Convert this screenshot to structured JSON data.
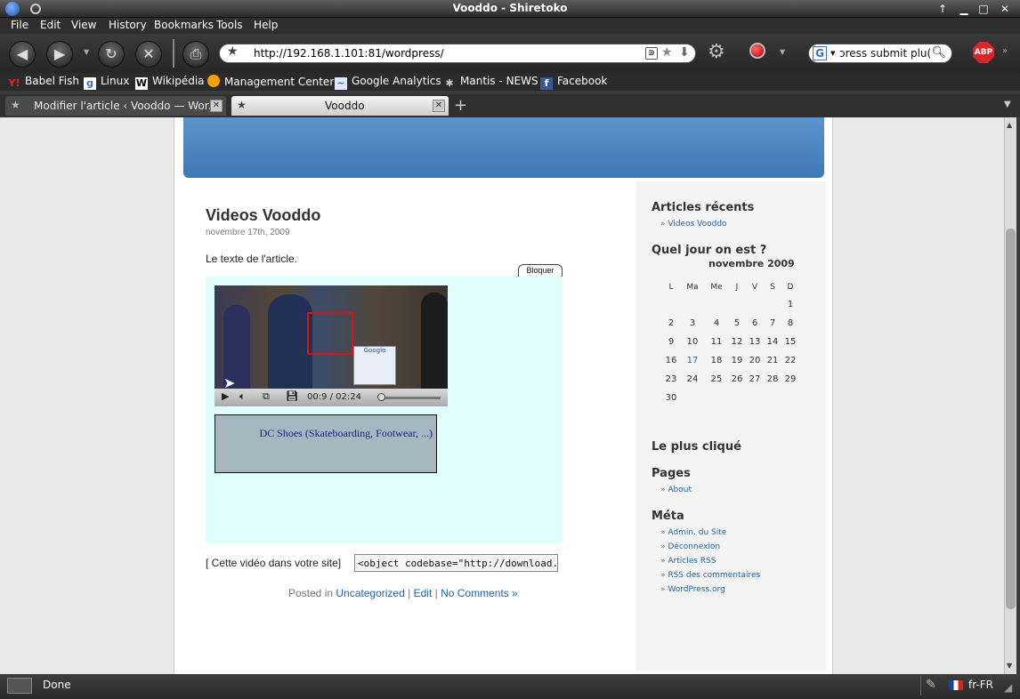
{
  "window": {
    "title": "Vooddo - Shiretoko"
  },
  "menu": {
    "file": "File",
    "edit": "Edit",
    "view": "View",
    "history": "History",
    "bookmarks": "Bookmarks",
    "tools": "Tools",
    "help": "Help"
  },
  "toolbar": {
    "url": "http://192.168.1.101:81/wordpress/",
    "search_value": "ɔress submit plu(",
    "search_engine": "G",
    "adblock": "ABP"
  },
  "bookmarks": [
    {
      "label": "Babel Fish",
      "icon": "yahoo-icon"
    },
    {
      "label": "Linux",
      "icon": "google-icon"
    },
    {
      "label": "Wikipédia",
      "icon": "wikipedia-icon"
    },
    {
      "label": "Management Center",
      "icon": "orange-circle-icon"
    },
    {
      "label": "Google Analytics",
      "icon": "analytics-icon"
    },
    {
      "label": "Mantis - NEWS",
      "icon": "bug-icon"
    },
    {
      "label": "Facebook",
      "icon": "facebook-icon"
    }
  ],
  "tabs": [
    {
      "label": "Modifier l'article ‹ Vooddo — Wor...",
      "active": false
    },
    {
      "label": "Vooddo",
      "active": true
    }
  ],
  "post": {
    "title": "Videos Vooddo",
    "date": "novembre 17th, 2009",
    "text": "Le texte de l'article.",
    "bloquer": "Bloquer",
    "video_time": "00:9 / 02:24",
    "video_progress": 0.06,
    "ad_text": "DC Shoes (Skateboarding, Footwear, ...)",
    "ad_overlay": "Google",
    "embed_label": "[ Cette vidéo dans votre site]",
    "embed_code": "<object codebase=\"http://download.ma",
    "meta_posted": "Posted in",
    "meta_category": "Uncategorized",
    "meta_sep1": "|",
    "meta_edit": "Edit",
    "meta_sep2": "|",
    "meta_comments": "No Comments »"
  },
  "sidebar": {
    "recent_title": "Articles récents",
    "recent_items": [
      "Videos Vooddo"
    ],
    "calendar_title": "Quel jour on est ?",
    "calendar_caption": "novembre 2009",
    "calendar_days": [
      "L",
      "Ma",
      "Me",
      "J",
      "V",
      "S",
      "D"
    ],
    "calendar_weeks": [
      [
        "",
        "",
        "",
        "",
        "",
        "",
        "1"
      ],
      [
        "2",
        "3",
        "4",
        "5",
        "6",
        "7",
        "8"
      ],
      [
        "9",
        "10",
        "11",
        "12",
        "13",
        "14",
        "15"
      ],
      [
        "16",
        "17",
        "18",
        "19",
        "20",
        "21",
        "22"
      ],
      [
        "23",
        "24",
        "25",
        "26",
        "27",
        "28",
        "29"
      ],
      [
        "30",
        "",
        "",
        "",
        "",
        "",
        ""
      ]
    ],
    "calendar_today": "17",
    "popular_title": "Le plus cliqué",
    "pages_title": "Pages",
    "pages_items": [
      "About"
    ],
    "meta_title": "Méta",
    "meta_items": [
      "Admin. du Site",
      "Déconnexion",
      "Articles RSS",
      "RSS des commentaires",
      "WordPress.org"
    ]
  },
  "status": {
    "text": "Done",
    "language": "fr-FR"
  },
  "colors": {
    "accent": "#2266aa",
    "header_blue": "#4a86c3",
    "video_bg": "#e0ffff"
  }
}
